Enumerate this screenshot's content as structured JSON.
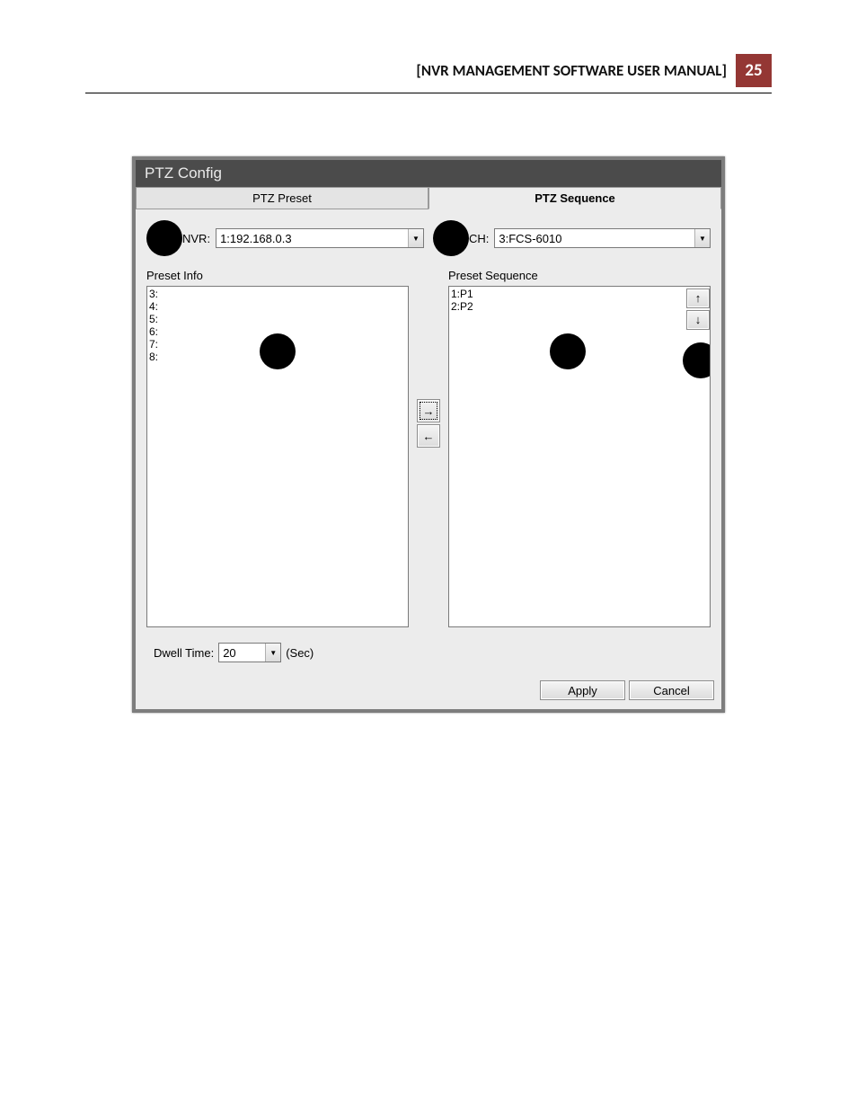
{
  "header": {
    "title": "[NVR MANAGEMENT SOFTWARE USER MANUAL]",
    "page": "25"
  },
  "window": {
    "title": "PTZ Config",
    "tabs": {
      "preset": "PTZ Preset",
      "sequence": "PTZ Sequence"
    },
    "nvr": {
      "label": "NVR:",
      "value": "1:192.168.0.3"
    },
    "ch": {
      "label": "CH:",
      "value": "3:FCS-6010"
    },
    "preset_info": {
      "label": "Preset Info",
      "items": [
        "3:",
        "4:",
        "5:",
        "6:",
        "7:",
        "8:"
      ]
    },
    "preset_seq": {
      "label": "Preset Sequence",
      "items": [
        "1:P1",
        "2:P2"
      ]
    },
    "arrows": {
      "right": "→",
      "left": "←",
      "up": "↑",
      "down": "↓"
    },
    "dwell": {
      "label": "Dwell Time:",
      "value": "20",
      "unit": "(Sec)"
    },
    "buttons": {
      "apply": "Apply",
      "cancel": "Cancel"
    }
  }
}
